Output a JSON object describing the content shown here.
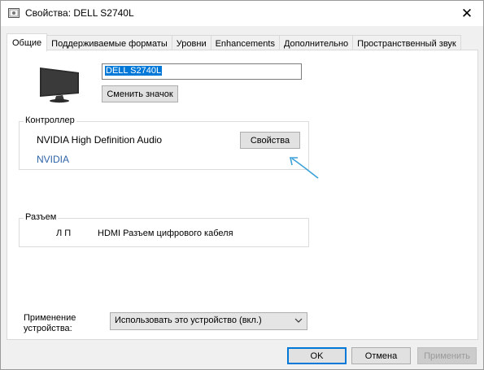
{
  "window": {
    "title": "Свойства: DELL S2740L",
    "close_glyph": "✕"
  },
  "tabs": [
    {
      "label": "Общие",
      "active": true
    },
    {
      "label": "Поддерживаемые форматы",
      "active": false
    },
    {
      "label": "Уровни",
      "active": false
    },
    {
      "label": "Enhancements",
      "active": false
    },
    {
      "label": "Дополнительно",
      "active": false
    },
    {
      "label": "Пространственный звук",
      "active": false
    }
  ],
  "general": {
    "device_name": "DELL S2740L",
    "change_icon_label": "Сменить значок",
    "controller": {
      "group_label": "Контроллер",
      "name": "NVIDIA High Definition Audio",
      "vendor": "NVIDIA",
      "properties_label": "Свойства"
    },
    "connector": {
      "group_label": "Разъем",
      "position": "Л П",
      "description": "HDMI Разъем цифрового кабеля"
    },
    "usage": {
      "label_line1": "Применение",
      "label_line2": "устройства:",
      "selected": "Использовать это устройство (вкл.)"
    }
  },
  "footer": {
    "ok_label": "OK",
    "cancel_label": "Отмена",
    "apply_label": "Применить"
  },
  "colors": {
    "accent": "#0078d7",
    "link_blue": "#2e63a9",
    "cursor_arrow": "#3aa0d8"
  }
}
